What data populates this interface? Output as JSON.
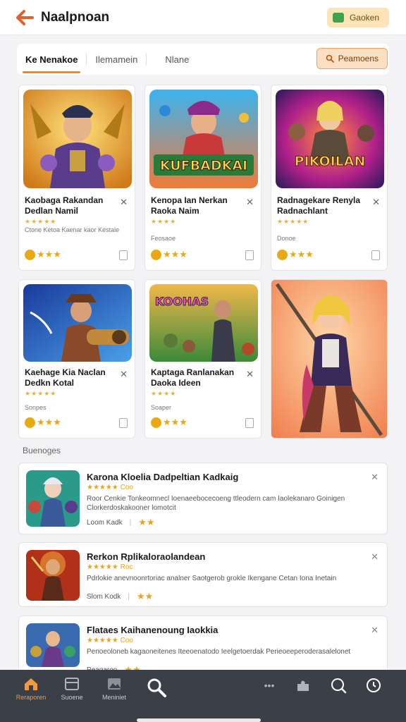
{
  "header": {
    "title": "Naalpnoan",
    "action_label": "Gaoken",
    "accent": "#f08a24"
  },
  "tabs": {
    "items": [
      {
        "label": "Ke Nenakoe",
        "active": true
      },
      {
        "label": "Ilemamein",
        "active": false
      },
      {
        "label": "Nlane",
        "active": false
      }
    ],
    "filter_label": "Peamoens"
  },
  "cards": [
    {
      "title": "Kaobaga Rakandan Dedlan Namil",
      "desc": "Ctone Ketoa Kaenar kaor Kestale",
      "art": "hero-armor"
    },
    {
      "title": "Kenopa Ian Nerkan Raoka Naim",
      "desc": "Feosaoe",
      "art": "kufbadkai"
    },
    {
      "title": "Radnagekare Renyla Radnachlant",
      "desc": "Donoe",
      "art": "pikoilan"
    },
    {
      "title": "Kaehage Kia Naclan Dedkn Kotal",
      "desc": "Sonpes",
      "art": "steampunk"
    },
    {
      "title": "Kaptaga Ranlanakan Daoka Ideen",
      "desc": "Soaper",
      "art": "battle"
    }
  ],
  "section_label": "Buenoges",
  "list_items": [
    {
      "title": "Karona Kloelia Dadpeltian Kadkaig",
      "rating": "Coo",
      "desc": "Roor Cenkie Tonkeomnecl Ioenaeebocecoeng ttleodern cam Iaolekanaro Goinigen Clorkerdoskakooner lomotcit",
      "meta": "Loom Kadk"
    },
    {
      "title": "Rerkon Rplikaloraolandean",
      "rating": "Roc",
      "desc": "Pdrlokie anevnoonrtoriac analner Saotgerob grokle Ikengane Cetan Iona Inetain",
      "meta": "Slom Kodk"
    },
    {
      "title": "Flataes Kaihanenoung Iaokkia",
      "rating": "Coo",
      "desc": "Penoeoloneb kagaoneitenes Iteeoenatodo Ieelgetoerdak Perieoeeperoderasalelonet",
      "meta": "Peagaroo"
    }
  ],
  "nav": [
    {
      "label": "Reraporen",
      "icon": "home-icon",
      "active": true
    },
    {
      "label": "Suoene",
      "icon": "grid-icon",
      "active": false
    },
    {
      "label": "Meniniet",
      "icon": "image-icon",
      "active": false
    }
  ]
}
